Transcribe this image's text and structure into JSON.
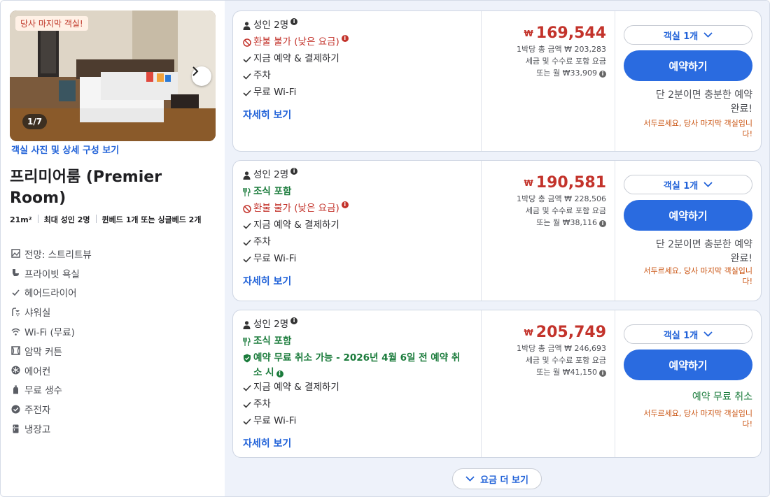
{
  "photo": {
    "badge": "당사 마지막 객실!",
    "counter": "1/7",
    "link": "객실 사진 및 상세 구성 보기"
  },
  "room": {
    "title": "프리미어룸 (Premier Room)",
    "size": "21m²",
    "occupancy": "최대 성인 2명",
    "beds": "퀸베드 1개 또는 싱글베드 2개"
  },
  "amenities": [
    {
      "icon": "view-icon",
      "label": "전망: 스트리트뷰"
    },
    {
      "icon": "toilet-icon",
      "label": "프라이빗 욕실"
    },
    {
      "icon": "check-icon",
      "label": "헤어드라이어"
    },
    {
      "icon": "shower-icon",
      "label": "샤워실"
    },
    {
      "icon": "wifi-icon",
      "label": "Wi-Fi (무료)"
    },
    {
      "icon": "curtain-icon",
      "label": "암막 커튼"
    },
    {
      "icon": "snowflake-icon",
      "label": "에어컨"
    },
    {
      "icon": "bottle-icon",
      "label": "무료 생수"
    },
    {
      "icon": "kettle-icon",
      "label": "주전자"
    },
    {
      "icon": "fridge-icon",
      "label": "냉장고"
    }
  ],
  "offers": [
    {
      "guests": "성인 2명",
      "breakfast": "",
      "policy": "환불 불가 (낮은 요금)",
      "policy_type": "red",
      "pay": "지금 예약 & 결제하기",
      "parking": "주차",
      "wifi": "무료 Wi-Fi",
      "details": "자세히 보기",
      "currency": "₩",
      "price": "169,544",
      "nightly_total": "1박당 총 금액 ₩ 203,283",
      "tax_note": "세금 및 수수료 포함 요금",
      "monthly": "또는 월 ₩33,909",
      "room_count": "객실 1개",
      "book": "예약하기",
      "promo_line1": "단 2분이면 충분한 예약",
      "promo_line2": "완료!",
      "urgent_line1": "서두르세요, 당사 마지막 객실입니",
      "urgent_line2": "다!"
    },
    {
      "guests": "성인 2명",
      "breakfast": "조식 포함",
      "policy": "환불 불가 (낮은 요금)",
      "policy_type": "red",
      "pay": "지금 예약 & 결제하기",
      "parking": "주차",
      "wifi": "무료 Wi-Fi",
      "details": "자세히 보기",
      "currency": "₩",
      "price": "190,581",
      "nightly_total": "1박당 총 금액 ₩ 228,506",
      "tax_note": "세금 및 수수료 포함 요금",
      "monthly": "또는 월 ₩38,116",
      "room_count": "객실 1개",
      "book": "예약하기",
      "promo_line1": "단 2분이면 충분한 예약",
      "promo_line2": "완료!",
      "urgent_line1": "서두르세요, 당사 마지막 객실입니",
      "urgent_line2": "다!"
    },
    {
      "guests": "성인 2명",
      "breakfast": "조식 포함",
      "policy_line1": "예약 무료 취소 가능 - 2026년 4월 6일 전 예약 취",
      "policy_line2": "소 시",
      "policy_type": "green",
      "pay": "지금 예약 & 결제하기",
      "parking": "주차",
      "wifi": "무료 Wi-Fi",
      "details": "자세히 보기",
      "currency": "₩",
      "price": "205,749",
      "nightly_total": "1박당 총 금액 ₩ 246,693",
      "tax_note": "세금 및 수수료 포함 요금",
      "monthly": "또는 월 ₩41,150",
      "room_count": "객실 1개",
      "book": "예약하기",
      "promo_line1": "예약 무료 취소",
      "urgent_line1": "서두르세요, 당사 마지막 객실입니",
      "urgent_line2": "다!"
    }
  ],
  "more_rates": "요금 더 보기",
  "colors": {
    "accent": "#2a6be0",
    "price": "#c3332b",
    "green": "#1a7b3b",
    "urgent": "#c9520f"
  }
}
